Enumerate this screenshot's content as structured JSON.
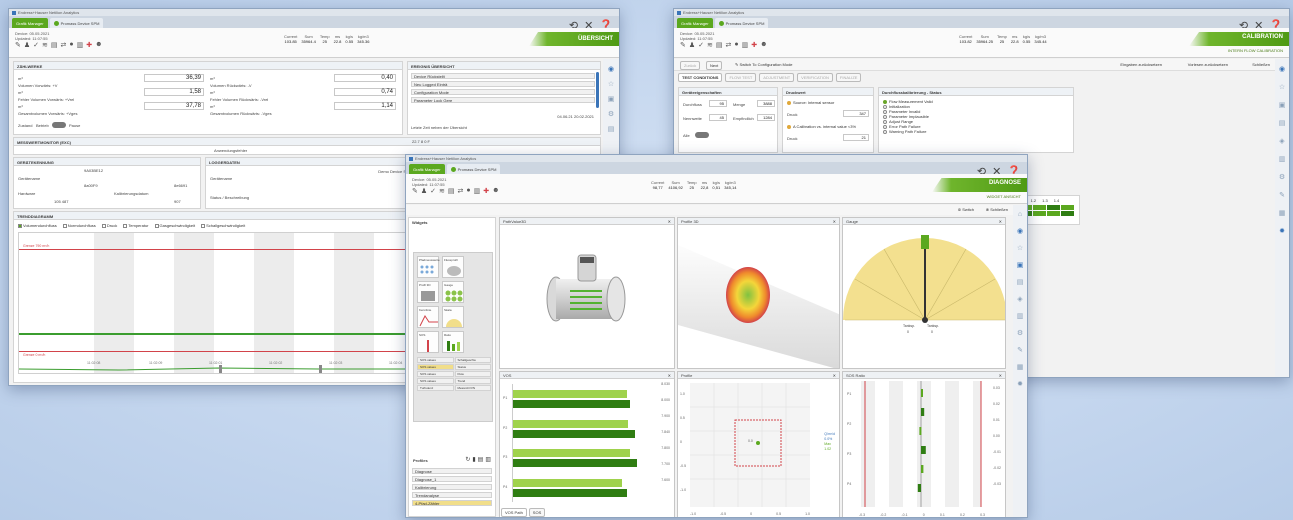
{
  "back_window": {
    "titlebar": "Endress+Hauser Netilion Analytics",
    "tab_active": "Grafik Manager",
    "tab_device": "Promass Device SPM",
    "tab_device_sub": "9A03C9E12",
    "meta_line1": "Device: 05.05.2021",
    "meta_line2": "Updated: 11:07:55",
    "stats": [
      {
        "label": "Current",
        "value": "103.85"
      },
      {
        "label": "Sum",
        "value": "35964.4"
      },
      {
        "label": "Temp",
        "value": "25"
      },
      {
        "label": "ms",
        "value": "22.8"
      },
      {
        "label": "kg/s",
        "value": "0.55"
      },
      {
        "label": "kg/m3",
        "value": "345.36"
      }
    ],
    "page_title": "ÜBERSICHT",
    "zaehlwerk": {
      "title": "ZÄHLWERKE",
      "rows_left": [
        {
          "unit": "m³",
          "value": "36,39",
          "label": "Volumen Vorwärts: +V"
        },
        {
          "unit": "m³",
          "value": "1,58",
          "label": "Fehler Volumen Vorwärts: +Vrel"
        },
        {
          "unit": "m³",
          "value": "37,78",
          "label": "Gesamtvolumen Vorwärts: +Vges"
        }
      ],
      "rows_right": [
        {
          "unit": "m³",
          "value": "0,40",
          "label": "Volumen Rückwärts: -V"
        },
        {
          "unit": "m³",
          "value": "0,74",
          "label": "Fehler Volumen Rückwärts: -Vrel"
        },
        {
          "unit": "m³",
          "value": "1,14",
          "label": "Gesamtvolumen Rückwärts: -Vges"
        }
      ],
      "control_label": "Zustand",
      "control_value": "Betrieb",
      "control_state": "Pause"
    },
    "ereignis": {
      "title": "EREIGNIS ÜBERSICHT",
      "items": [
        "Device Rückstellt",
        "Neu Logged Einträ",
        "Configuration Mode",
        "Parameter Lock Gere"
      ],
      "date": "04.06.21 20.02.2021",
      "footer": "Letzte Zeit neben der Übersicht"
    },
    "messwert": {
      "title": "MESSWERTMONITOR (EXC)",
      "value": "22.7 8 0 F",
      "sub": "Anwendungsfehler"
    },
    "geraet": {
      "title": "GERÄTEKENNUNG",
      "serial": "9A03BE12",
      "fields": [
        {
          "label": "Gerätename",
          "value": "8a00F9"
        },
        {
          "label": "Firmware DD",
          "value": "8e6691"
        },
        {
          "label": "Hardware",
          "value": "105 487"
        },
        {
          "label": "Kalibrierungsdatum",
          "value": "907"
        }
      ]
    },
    "logger": {
      "title": "LOGGERDATEN",
      "device": "Demo Device SPM",
      "field": "Gerätename",
      "sub": "Status / Beschreibung"
    },
    "trend": {
      "title": "TRENDDIAGRAMM",
      "checkboxes": [
        "Volumendurchfluss",
        "Normdurchfluss",
        "Druck",
        "Temperatur",
        "Gasgeschwindigkeit",
        "Schallgeschwindigkeit"
      ],
      "upper_label": "Grenze 790 m³/h",
      "lower_label": "Grenze 0 m³/h",
      "x_ticks": [
        "11:02:08",
        "11:02:09",
        "11:02:01",
        "11:02:02",
        "11:02:03",
        "11:02:04"
      ]
    }
  },
  "right_window": {
    "titlebar": "Endress+Hauser Netilion Analytics",
    "tab_active": "Grafik Manager",
    "tab_device": "Promass Device SPM",
    "tab_device_sub": "9A03C9E12",
    "meta_line1": "Device: 05.05.2021",
    "meta_line2": "Updated: 11:07:55",
    "stats": [
      {
        "label": "Current",
        "value": "103.82"
      },
      {
        "label": "Sum",
        "value": "35964.25"
      },
      {
        "label": "Temp",
        "value": "25"
      },
      {
        "label": "ms",
        "value": "22.8"
      },
      {
        "label": "kg/s",
        "value": "0.55"
      },
      {
        "label": "kg/m3",
        "value": "345.44"
      }
    ],
    "page_title": "CALIBRATION",
    "page_subtitle": "INTERN FLOW CALIBRATION",
    "nav_back": "Zurück",
    "nav_next": "Next",
    "nav_switch": "Switch To Configuration Mode",
    "nav_right": [
      "Eingaben zurücksetzen",
      "Vorlesen zurücksetzen",
      "Schließen"
    ],
    "steps": [
      "TEST CONDITIONS",
      "FLOW TEST",
      "ADJUSTMENT",
      "VERIFICATION",
      "FINALIZE"
    ],
    "conditions": {
      "title": "Geräteeigenschaften",
      "rows": [
        {
          "l": "Durchfluss",
          "v": "95"
        },
        {
          "l": "Menge",
          "v": "3888"
        },
        {
          "l": "Nennweite",
          "v": "45"
        },
        {
          "l": "Empfindlich",
          "v": "1284"
        }
      ],
      "toggle_label": "Alle"
    },
    "druck": {
      "title": "Druckwert",
      "status1": "Source: Internal sensor",
      "field": "Druck",
      "value": "347",
      "status2": "A Calibration vs. internal value <3%",
      "field2": "Druck",
      "value2": "21"
    },
    "status": {
      "title": "Durchflusskalibrierung - Status",
      "items": [
        "Flow Measurement Valid",
        "Initialization",
        "Parameter Invalid",
        "Parameter Implausible",
        "Adjust Range",
        "Error Path Failure",
        "Warning Path Failure"
      ]
    },
    "mini_table": {
      "headers": [
        "1.1",
        "1.2",
        "1.3",
        "1.4"
      ]
    }
  },
  "front_window": {
    "titlebar": "Endress+Hauser Netilion Analytics",
    "tab_active": "Grafik Manager",
    "tab_device": "Promass Device SPM",
    "tab_device_sub": "9A03C9E12",
    "meta_line1": "Device: 05.05.2021",
    "meta_line2": "Updated: 11:07:55",
    "stats": [
      {
        "label": "Current",
        "value": "98,77"
      },
      {
        "label": "Sum",
        "value": "4106,92"
      },
      {
        "label": "Temp",
        "value": "25"
      },
      {
        "label": "ms",
        "value": "22,8"
      },
      {
        "label": "kg/s",
        "value": "0,51"
      },
      {
        "label": "kg/m3",
        "value": "345,14"
      }
    ],
    "page_title": "DIAGNOSE",
    "page_subtitle": "WIDGET ANSICHT",
    "actions": [
      "Switch",
      "Schließen"
    ],
    "widgets_title": "Widgets",
    "widget_labels": [
      "Pfadmesswerte",
      "Flussprofil",
      "Profil 3D",
      "Gauge",
      "Kennlinie",
      "Skala",
      "SOS",
      "Ratio"
    ],
    "widget_list": [
      "SOS values",
      "Schallgeschw",
      "SOS values",
      "Status",
      "SOS values",
      "Flow",
      "SOS values",
      "Trend",
      "Turbulenz",
      "Messrohr/VN"
    ],
    "profiles_title": "Profiles",
    "profile_list": [
      "Diagnose",
      "Diagnose_1",
      "Kalibrierung",
      "Trendanalyse",
      "4-Pfad-Zähler"
    ],
    "panels": {
      "p1": "PathValue3D",
      "p2": "Profile 3D",
      "p3": "Gauge",
      "p4": "VOS",
      "p5": "Profile",
      "p6": "SOS Ratio"
    },
    "gauge": {
      "left_label": "Tanksp.",
      "right_label": "Tanksp.",
      "left_value": "0",
      "right_value": "0"
    },
    "vos": {
      "categories": [
        "P1",
        "P2",
        "P3",
        "P4"
      ],
      "series": [
        {
          "name": "A",
          "values": [
            7.0,
            7.1,
            7.2,
            6.7
          ]
        },
        {
          "name": "B",
          "values": [
            7.2,
            7.5,
            7.6,
            7.0
          ]
        }
      ],
      "right_ticks": [
        "8.030",
        "8.000",
        "7.900",
        "7.840",
        "7.800",
        "7.700",
        "7.600"
      ]
    },
    "profile_plot": {
      "left_ticks": [
        "1.0",
        "0.5",
        "0",
        "-0.5",
        "-1.0"
      ],
      "x_ticks": [
        "-1.0",
        "-0.5",
        "0",
        "0.5",
        "1.0"
      ],
      "legend": [
        "Q/m³/d",
        "0.0%",
        "Max",
        "1.02"
      ],
      "center_label": "0.0"
    },
    "sos": {
      "y_ticks": [
        "P1",
        "P2",
        "P3",
        "P4"
      ],
      "right_ticks": [
        "0.03",
        "0.02",
        "0.01",
        "0.00",
        "-0.01",
        "-0.02",
        "-0.03"
      ],
      "x_ticks": [
        "-0.3",
        "-0.2",
        "-0.1",
        "0",
        "0.1",
        "0.2",
        "0.3"
      ],
      "values": [
        0.01,
        0.02,
        -0.01,
        0.03,
        0.015,
        -0.02
      ]
    },
    "bottom_tabs": [
      "VOS Path",
      "SOS"
    ]
  },
  "colors": {
    "accent_green": "#5ba81f",
    "dark_green": "#2f7d12",
    "light_green": "#9fd24c",
    "limit_red": "#d2434a",
    "line_green": "#3b9d2f"
  }
}
